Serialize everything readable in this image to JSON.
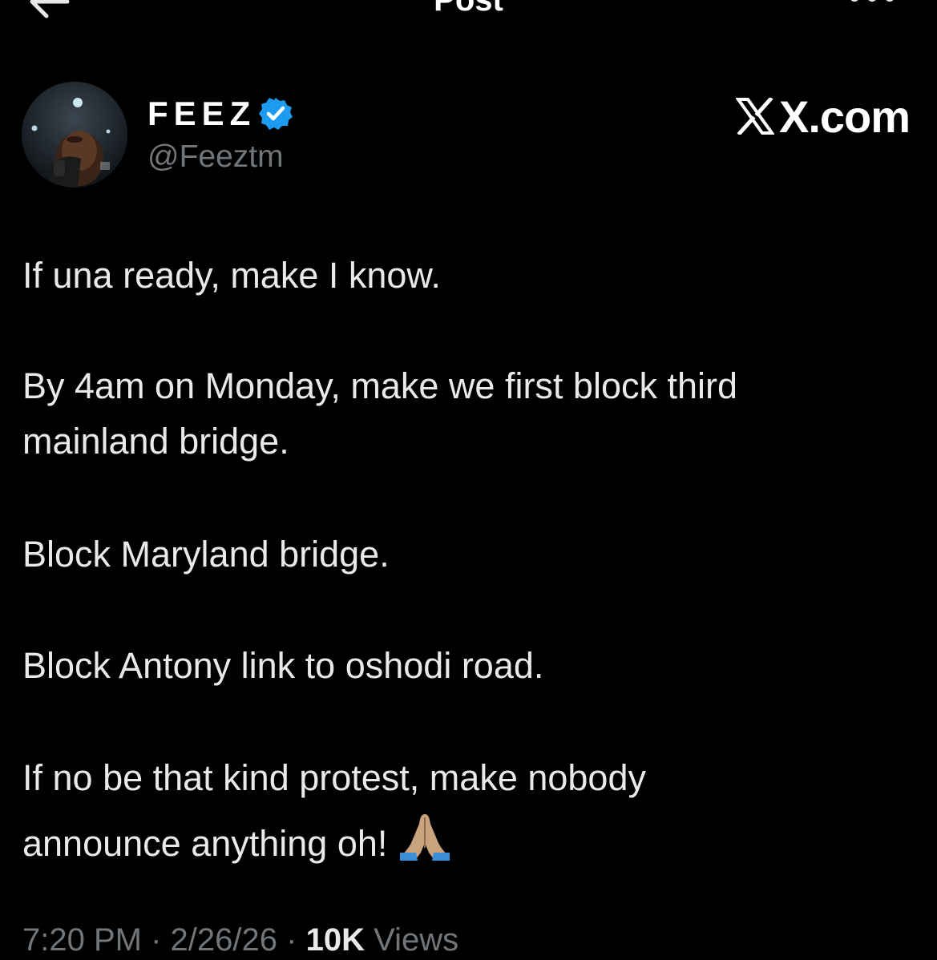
{
  "header": {
    "title": "Post",
    "back_icon": "arrow-left-icon",
    "more_icon": "more-horizontal-icon"
  },
  "author": {
    "display_name": "FEEZ",
    "handle": "@Feeztm",
    "verified": true,
    "verified_color": "#1d9bf0"
  },
  "watermark": {
    "text": "X.com",
    "icon": "x-logo-icon"
  },
  "post": {
    "paragraphs": [
      [
        "If una ready, make I know."
      ],
      [
        "By 4am on Monday, make we first block third",
        "mainland bridge."
      ],
      [
        "Block Maryland bridge."
      ],
      [
        "Block Antony link to oshodi road."
      ],
      [
        "If no be that kind protest, make nobody",
        "announce anything oh!"
      ]
    ],
    "emoji": "folded-hands-emoji"
  },
  "meta": {
    "time": "7:20 PM",
    "separator": "·",
    "date": "2/26/26",
    "views_count": "10K",
    "views_label": "Views"
  },
  "colors": {
    "background": "#000000",
    "text_primary": "#e7e9ea",
    "text_secondary": "#71767b",
    "accent": "#1d9bf0"
  }
}
